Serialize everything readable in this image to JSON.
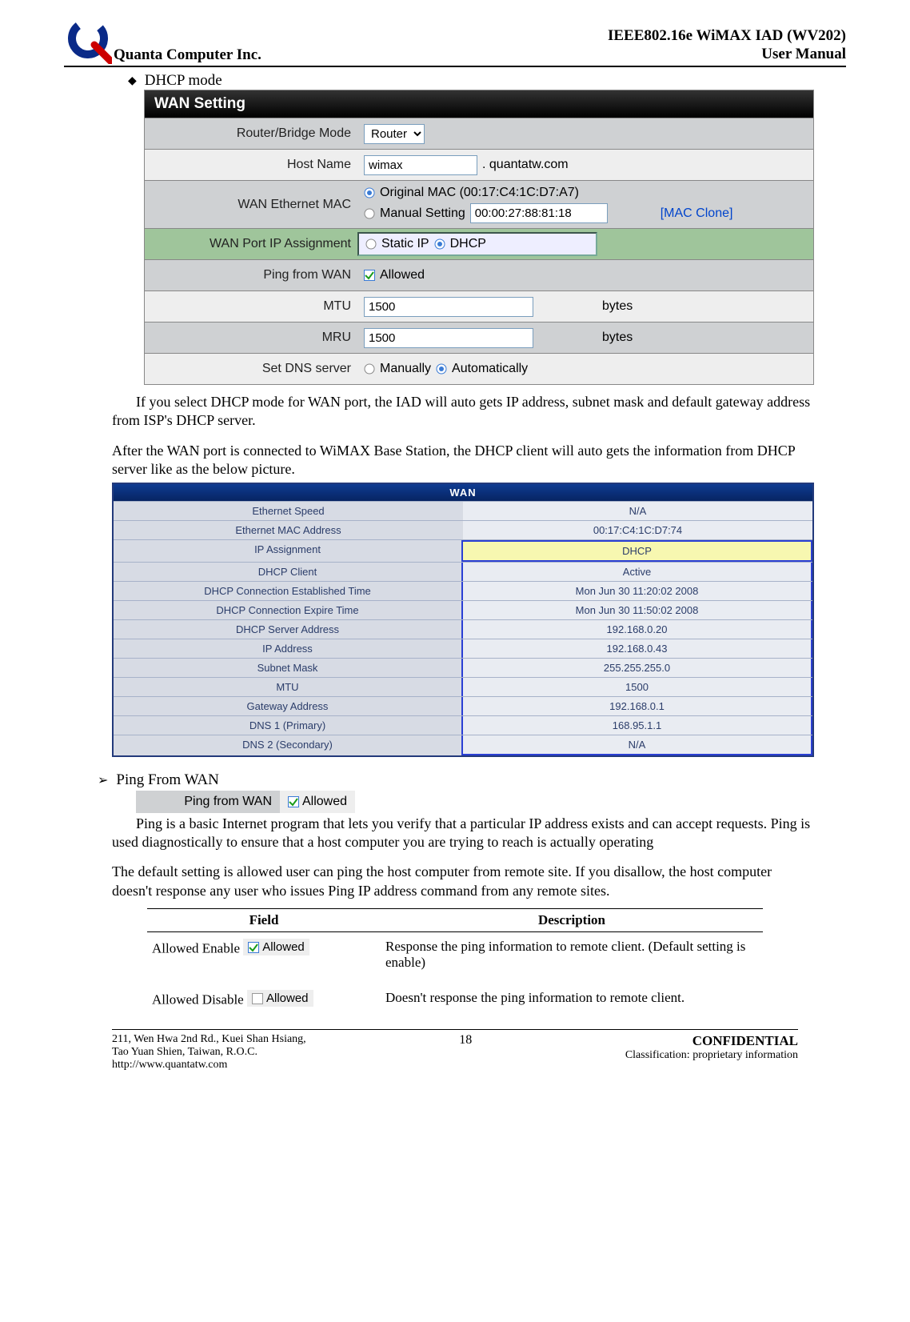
{
  "header": {
    "company": "Quanta  Computer  Inc.",
    "title_line1": "IEEE802.16e  WiMAX  IAD  (WV202)",
    "title_line2": "User  Manual"
  },
  "bullet": {
    "text": "DHCP mode"
  },
  "wan_setting": {
    "title": "WAN Setting",
    "rows": {
      "router_bridge": {
        "label": "Router/Bridge Mode",
        "value": "Router"
      },
      "host_name": {
        "label": "Host Name",
        "value": "wimax",
        "suffix": ". quantatw.com"
      },
      "wan_mac": {
        "label": "WAN Ethernet MAC",
        "opt1": "Original MAC (00:17:C4:1C:D7:A7)",
        "opt2": "Manual Setting",
        "manual_val": "00:00:27:88:81:18",
        "clone": "[MAC Clone]"
      },
      "port_ip": {
        "label": "WAN Port IP Assignment",
        "opt1": "Static IP",
        "opt2": "DHCP"
      },
      "ping": {
        "label": "Ping from WAN",
        "chk": "Allowed"
      },
      "mtu": {
        "label": "MTU",
        "value": "1500",
        "unit": "bytes"
      },
      "mru": {
        "label": "MRU",
        "value": "1500",
        "unit": "bytes"
      },
      "dns": {
        "label": "Set DNS server",
        "opt1": "Manually",
        "opt2": "Automatically"
      }
    }
  },
  "para1": "If you select DHCP mode for WAN port, the IAD will auto gets IP address, subnet mask and default gateway address from ISP's DHCP server.",
  "para2": "After the WAN port is connected to WiMAX Base Station, the DHCP client will auto gets the information from DHCP server like as the below picture.",
  "wan_status": {
    "title": "WAN",
    "rows": [
      {
        "label": "Ethernet Speed",
        "value": "N/A"
      },
      {
        "label": "Ethernet MAC Address",
        "value": "00:17:C4:1C:D7:74"
      },
      {
        "label": "IP Assignment",
        "value": "DHCP"
      },
      {
        "label": "DHCP Client",
        "value": "Active"
      },
      {
        "label": "DHCP Connection Established Time",
        "value": "Mon Jun 30 11:20:02 2008"
      },
      {
        "label": "DHCP Connection Expire Time",
        "value": "Mon Jun 30 11:50:02 2008"
      },
      {
        "label": "DHCP Server Address",
        "value": "192.168.0.20"
      },
      {
        "label": "IP Address",
        "value": "192.168.0.43"
      },
      {
        "label": "Subnet Mask",
        "value": "255.255.255.0"
      },
      {
        "label": "MTU",
        "value": "1500"
      },
      {
        "label": "Gateway Address",
        "value": "192.168.0.1"
      },
      {
        "label": "DNS 1 (Primary)",
        "value": "168.95.1.1"
      },
      {
        "label": "DNS 2 (Secondary)",
        "value": "N/A"
      }
    ]
  },
  "ping_section": {
    "heading": "Ping From WAN",
    "label": "Ping from WAN",
    "chk": "Allowed"
  },
  "para3": "Ping is a basic Internet program that lets you verify that a particular IP address exists and can accept requests. Ping is used diagnostically to ensure that a host computer you are trying to reach is actually operating",
  "para4": "The default setting is allowed user can ping the host computer from remote site. If you disallow, the host computer doesn't response any user who issues Ping IP address command from any remote sites.",
  "field_table": {
    "h1": "Field",
    "h2": "Description",
    "r1_f": "Allowed Enable",
    "r1_chk": "Allowed",
    "r1_d": "Response the ping information to remote client. (Default setting is enable)",
    "r2_f": "Allowed Disable",
    "r2_chk": "Allowed",
    "r2_d": "Doesn't response the ping information to remote client."
  },
  "footer": {
    "addr1": "211, Wen Hwa 2nd Rd., Kuei Shan Hsiang,",
    "addr2": "Tao Yuan Shien, Taiwan, R.O.C.",
    "addr3": "http://www.quantatw.com",
    "page": "18",
    "conf": "CONFIDENTIAL",
    "class": "Classification: proprietary information"
  }
}
